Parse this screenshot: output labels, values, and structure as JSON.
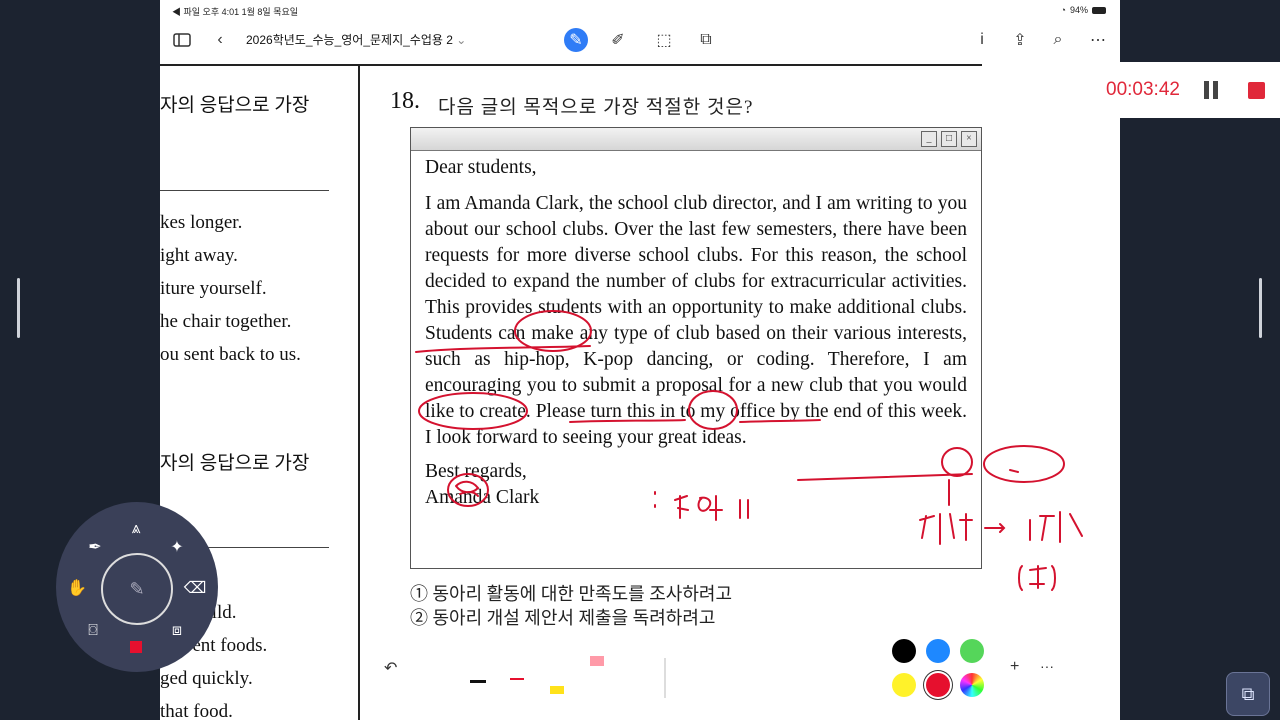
{
  "status_bar": {
    "left": "◀ 파일  오후 4:01  1월 8일 목요일",
    "battery": "94%"
  },
  "toolbar": {
    "title": "2026학년도_수능_영어_문제지_수업용 2",
    "title_chevron": "⌄",
    "icons": [
      "sidebar-icon",
      "back-chevron-icon",
      "pen-mode-icon",
      "highlighter-icon",
      "lasso-select-icon",
      "add-page-icon",
      "info-icon",
      "share-icon",
      "search-icon",
      "more-icon"
    ]
  },
  "left_column": {
    "line1": "자의 응답으로 가장",
    "line2": "kes longer.",
    "line3": "ight away.",
    "line4": "iture yourself.",
    "line5": "he chair together.",
    "line6": "ou sent back to us.",
    "line7": "자의 응답으로 가장",
    "line8": "as a child.",
    "line9": "ifferent foods.",
    "line10": "ged quickly.",
    "line11": " that food."
  },
  "question": {
    "number": "18.",
    "text": "다음 글의 목적으로 가장 적절한 것은?"
  },
  "letter": {
    "greeting": "Dear students,",
    "body": "I am Amanda Clark, the school club director, and I am writing to you about our school clubs. Over the last few semesters, there have been requests for more diverse school clubs. For this reason, the school decided to expand the number of clubs for extracurricular activities. This provides students with an opportunity to make additional clubs. Students can make any type of club based on their various interests, such as hip-hop, K-pop dancing, or coding. Therefore, I am encouraging you to submit a proposal for a new club that you would like to create. Please turn this in to my office by the end of this week. I look forward to seeing your great ideas.",
    "closing": "Best regards,",
    "signature": "Amanda Clark"
  },
  "choices": {
    "c1": "① 동아리 활동에 대한 만족도를 조사하려고",
    "c2": "② 동아리 개설 제안서 제출을 독려하려고"
  },
  "recording": {
    "time": "00:03:42"
  },
  "radial_menu": {
    "tools": [
      "fountain-pen-icon",
      "compass-icon",
      "magic-wand-icon",
      "eraser-icon",
      "briefcase-icon",
      "record-stop-icon",
      "camera-icon",
      "hand-icon",
      "pencil-icon"
    ]
  },
  "pen_toolbar": {
    "undo": "↶",
    "add": "+",
    "more": "···",
    "colors": {
      "black": "#000000",
      "blue": "#1e88ff",
      "green": "#55d65a",
      "yellow": "#fff22a",
      "red": "#e6102e"
    }
  },
  "annotation_colors": {
    "ink": "#d4122f"
  }
}
